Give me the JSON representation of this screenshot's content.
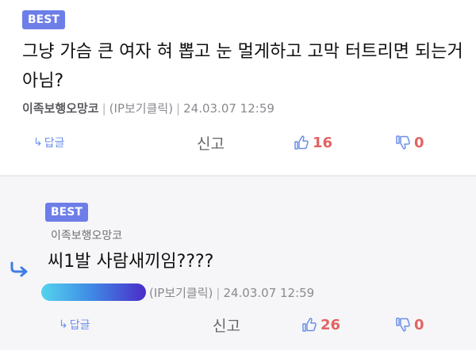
{
  "comments": [
    {
      "badge": "BEST",
      "text": "그냥 가슴 큰 여자 혀 뽑고 눈 멀게하고 고막 터트리면 되는거 아님?",
      "nickname": "이족보행오망코",
      "ip_label": "(IP보기클릭)",
      "timestamp": "24.03.07 12:59",
      "reply_label": "답글",
      "report_label": "신고",
      "upvotes": "16",
      "downvotes": "0"
    },
    {
      "badge": "BEST",
      "nickname": "이족보행오망코",
      "text": "씨1발 사람새끼임????",
      "ip_label": "(IP보기클릭)",
      "timestamp": "24.03.07 12:59",
      "reply_label": "답글",
      "report_label": "신고",
      "upvotes": "26",
      "downvotes": "0"
    }
  ],
  "colors": {
    "badge": "#6d7ee8",
    "accent_blue": "#6b8fe8",
    "vote_red": "#e26363",
    "reply_bg": "#f6f6f8"
  },
  "icons": {
    "reply": "reply-arrow-icon",
    "up": "thumbs-up-icon",
    "down": "thumbs-down-icon",
    "reply_indicator": "reply-indicator-icon"
  }
}
